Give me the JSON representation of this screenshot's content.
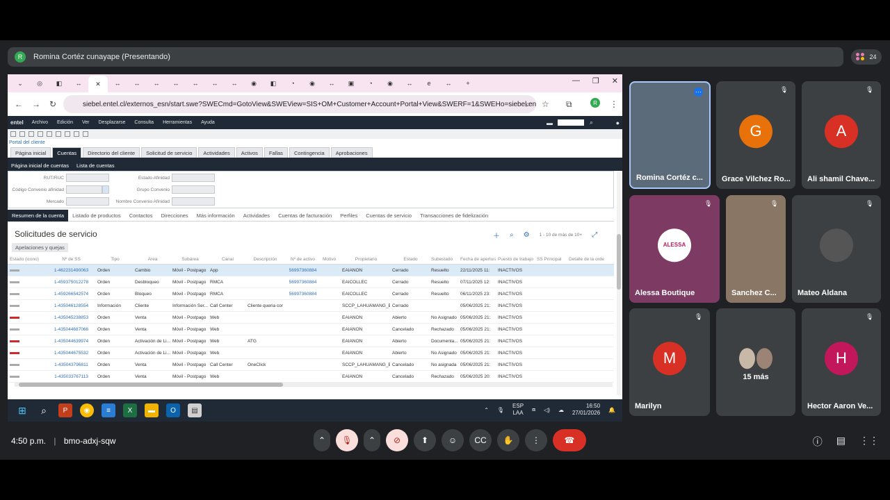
{
  "presenter_bar": {
    "avatar": "R",
    "title": "Romina Cortéz cunayape (Presentando)"
  },
  "participants_count": "24",
  "browser": {
    "url": "siebel.entel.cl/externos_esn/start.swe?SWECmd=GotoView&SWEView=SIS+OM+Customer+Account+Portal+View&SWERF=1&SWEHo=siebel.en...",
    "profile_initial": "R",
    "close_tab": "✕",
    "new_tab": "+"
  },
  "app": {
    "logo": "entel",
    "menu": [
      "Archivo",
      "Edición",
      "Ver",
      "Desplazarse",
      "Consulta",
      "Herramientas",
      "Ayuda"
    ],
    "breadcrumb": "Portal del cliente",
    "screen_tabs": [
      "Página inicial",
      "Cuentas",
      "Directorio del cliente",
      "Solicitud de servicio",
      "Actividades",
      "Activos",
      "Fallas",
      "Contingencia",
      "Aprobaciones"
    ],
    "sub_tabs": [
      "Página inicial de cuentas",
      "Lista de cuentas"
    ],
    "form_fields": {
      "rut": "RUT/RUC",
      "estado": "Estado Afinidad",
      "codigo": "Código Convenio afinidad",
      "grupo": "Grupo Convenio",
      "mercado": "Mercado",
      "nombre": "Nombre Convenio Afinidad"
    },
    "view_tabs": [
      "Resumen de la cuenta",
      "Listado de productos",
      "Contactos",
      "Direcciones",
      "Más información",
      "Actividades",
      "Cuentas de facturación",
      "Perfiles",
      "Cuentas de servicio",
      "Transacciones de fidelización"
    ],
    "section_title": "Solicitudes de servicio",
    "record_count": "1 - 10 de más de 10+",
    "subsection": "Apelaciones y quejas",
    "columns": [
      "Estado (icono)",
      "Nº de SS",
      "Tipo",
      "Área",
      "Subárea",
      "Canal",
      "Descripción",
      "Nº de activo",
      "Motivo",
      "Propietario",
      "Estado",
      "Subestado",
      "Fecha de apertura",
      "Puesto de trabajo",
      "SS Principal",
      "Detalle de la orde"
    ],
    "rows": [
      {
        "bar": "grey",
        "ss": "1-462231490063",
        "tipo": "Orden",
        "area": "Cambio",
        "subarea": "Móvil - Postpago",
        "canal": "App",
        "desc": "",
        "activo": "56997360884",
        "motivo": "",
        "prop": "EAIANON",
        "estado": "Cerrado",
        "subestado": "Resuelto",
        "fecha": "22/11/2025 11:",
        "puesto": "INACTIVOS"
      },
      {
        "bar": "grey",
        "ss": "1-459375012278",
        "tipo": "Orden",
        "area": "Desbloqueo",
        "subarea": "Móvil - Postpago",
        "canal": "RMCA",
        "desc": "",
        "activo": "56997360884",
        "motivo": "",
        "prop": "EAICOLLEC",
        "estado": "Cerrado",
        "subestado": "Resuelto",
        "fecha": "07/11/2025 12:",
        "puesto": "INACTIVOS"
      },
      {
        "bar": "grey",
        "ss": "1-459266542574",
        "tipo": "Orden",
        "area": "Bloqueo",
        "subarea": "Móvil - Postpago",
        "canal": "RMCA",
        "desc": "",
        "activo": "56997360884",
        "motivo": "",
        "prop": "EAICOLLEC",
        "estado": "Cerrado",
        "subestado": "Resuelto",
        "fecha": "06/11/2025 23:",
        "puesto": "INACTIVOS"
      },
      {
        "bar": "grey",
        "ss": "1-435046128554",
        "tipo": "Información",
        "area": "Cliente",
        "subarea": "Información Ser...",
        "canal": "Call Center",
        "desc": "Cliente queria con",
        "activo": "",
        "motivo": "",
        "prop": "SCCP_LAHUAMANG_B...",
        "estado": "Cerrado",
        "subestado": "",
        "fecha": "05/06/2025 21:",
        "puesto": "INACTIVOS"
      },
      {
        "bar": "red",
        "ss": "1-435045238853",
        "tipo": "Orden",
        "area": "Venta",
        "subarea": "Móvil - Postpago",
        "canal": "Web",
        "desc": "",
        "activo": "",
        "motivo": "",
        "prop": "EAIANON",
        "estado": "Abierto",
        "subestado": "No Asignado",
        "fecha": "05/06/2025 21:",
        "puesto": "INACTIVOS"
      },
      {
        "bar": "grey",
        "ss": "1-435044687066",
        "tipo": "Orden",
        "area": "Venta",
        "subarea": "Móvil - Postpago",
        "canal": "Web",
        "desc": "",
        "activo": "",
        "motivo": "",
        "prop": "EAIANON",
        "estado": "Cancelado",
        "subestado": "Rechazado",
        "fecha": "05/06/2025 21:",
        "puesto": "INACTIVOS"
      },
      {
        "bar": "red",
        "ss": "1-435044639974",
        "tipo": "Orden",
        "area": "Activación de Li...",
        "subarea": "Móvil - Postpago",
        "canal": "Web",
        "desc": "ATG",
        "activo": "",
        "motivo": "",
        "prop": "EAIANON",
        "estado": "Abierto",
        "subestado": "Documenta...",
        "fecha": "05/06/2025 21:",
        "puesto": "INACTIVOS"
      },
      {
        "bar": "red",
        "ss": "1-435044675532",
        "tipo": "Orden",
        "area": "Activación de Li...",
        "subarea": "Móvil - Postpago",
        "canal": "Web",
        "desc": "",
        "activo": "",
        "motivo": "",
        "prop": "EAIANON",
        "estado": "Abierto",
        "subestado": "No Asignado",
        "fecha": "05/06/2025 21:",
        "puesto": "INACTIVOS"
      },
      {
        "bar": "grey",
        "ss": "1-435043796811",
        "tipo": "Orden",
        "area": "Venta",
        "subarea": "Móvil - Postpago",
        "canal": "Call Center",
        "desc": "OneClick",
        "activo": "",
        "motivo": "",
        "prop": "SCCP_LAHUAMANG_B...",
        "estado": "Cancelado",
        "subestado": "No asignada",
        "fecha": "05/06/2025 21:",
        "puesto": "INACTIVOS"
      },
      {
        "bar": "grey",
        "ss": "1-435033767113",
        "tipo": "Orden",
        "area": "Venta",
        "subarea": "Móvil - Postpago",
        "canal": "Web",
        "desc": "",
        "activo": "",
        "motivo": "",
        "prop": "EAIANON",
        "estado": "Cancelado",
        "subestado": "Rechazado",
        "fecha": "05/06/2025 20:",
        "puesto": "INACTIVOS"
      }
    ]
  },
  "taskbar": {
    "lang1": "ESP",
    "lang2": "LAA",
    "time": "16:50",
    "date": "27/01/2026"
  },
  "tiles": [
    {
      "name": "Romina Cortéz c...",
      "initial": "",
      "color": "#6b7f93"
    },
    {
      "name": "Grace Vilchez Ro...",
      "initial": "G",
      "color": "#e8710a"
    },
    {
      "name": "Ali shamil Chave...",
      "initial": "A",
      "color": "#d93025"
    },
    {
      "name": "Alessa Boutique",
      "initial": "ALESSA",
      "color": "#ffffff"
    },
    {
      "name": "Sanchez C...",
      "initial": "",
      "color": "#7d6a5c"
    },
    {
      "name": "Mateo Aldana",
      "initial": "",
      "color": "#3c4a5a"
    },
    {
      "name": "Marilyn",
      "initial": "M",
      "color": "#d93025"
    },
    {
      "name": "15 más",
      "initial": "",
      "color": "#3c4043"
    },
    {
      "name": "Hector Aaron Ve...",
      "initial": "H",
      "color": "#c2185b"
    }
  ],
  "meeting": {
    "time": "4:50 p.m.",
    "code": "bmo-adxj-sqw"
  }
}
